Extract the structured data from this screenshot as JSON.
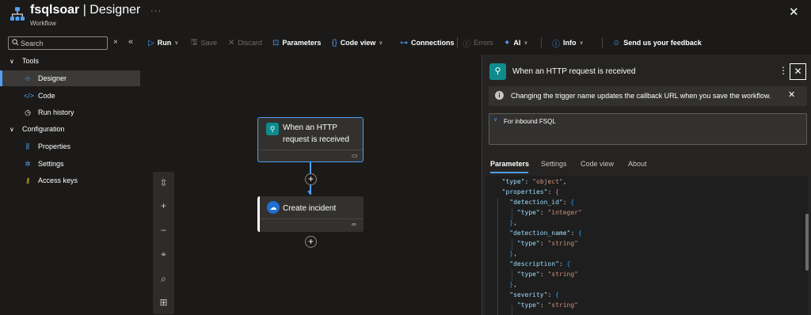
{
  "app": {
    "name": "fsqlsoar",
    "separator": " | ",
    "view": "Designer",
    "subtitle": "Workflow",
    "more": "···",
    "close": "✕"
  },
  "toolbar": {
    "run": "Run",
    "save": "Save",
    "discard": "Discard",
    "parameters": "Parameters",
    "code_view": "Code view",
    "connections": "Connections",
    "errors": "Errors",
    "ai": "AI",
    "info": "Info",
    "feedback": "Send us your feedback"
  },
  "sidebar": {
    "search_placeholder": "Search",
    "groups": [
      {
        "label": "Tools",
        "items": [
          {
            "label": "Designer",
            "icon": "designer-icon"
          },
          {
            "label": "Code",
            "icon": "code-icon"
          },
          {
            "label": "Run history",
            "icon": "clock-icon"
          }
        ]
      },
      {
        "label": "Configuration",
        "items": [
          {
            "label": "Properties",
            "icon": "properties-icon"
          },
          {
            "label": "Settings",
            "icon": "gear-icon"
          },
          {
            "label": "Access keys",
            "icon": "key-icon"
          }
        ]
      }
    ]
  },
  "canvas": {
    "trigger_title": "When an HTTP request is received",
    "action_title": "Create incident"
  },
  "panel": {
    "title": "When an HTTP request is received",
    "info": "Changing the trigger name updates the callback URL when you save the workflow.",
    "description": "For inbound FSQL",
    "tabs": [
      "Parameters",
      "Settings",
      "Code view",
      "About"
    ]
  },
  "code": {
    "k_type": "\"type\"",
    "v_object": "\"object\"",
    "k_properties": "\"properties\"",
    "k_detection_id": "\"detection_id\"",
    "v_integer": "\"integer\"",
    "k_detection_name": "\"detection_name\"",
    "v_string": "\"string\"",
    "k_description": "\"description\"",
    "k_severity": "\"severity\""
  },
  "colors": {
    "accent": "#4fa0f0",
    "background": "#1b1a19",
    "panel": "#252423",
    "teal_icon": "#0f8b8d"
  }
}
